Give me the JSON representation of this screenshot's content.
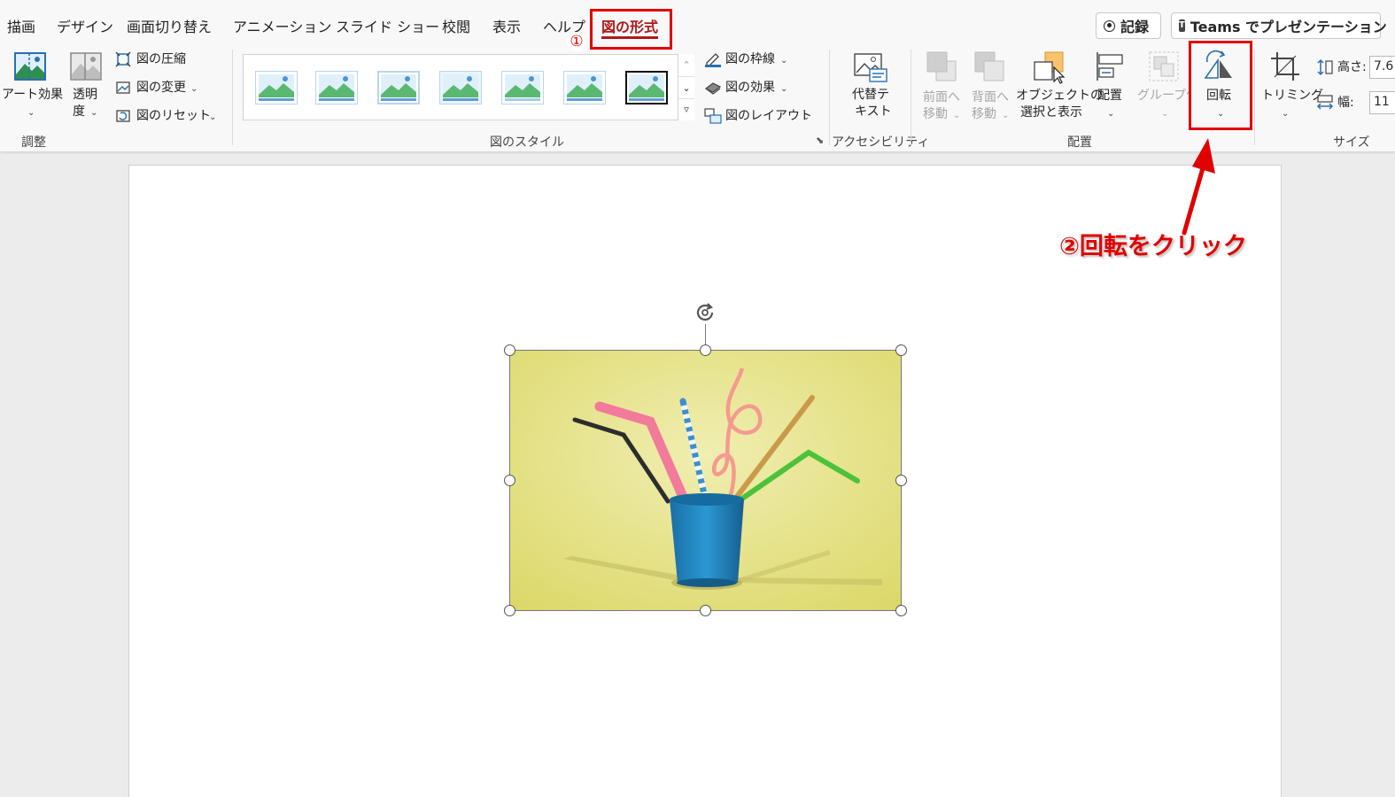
{
  "tabs": [
    {
      "label": "描画"
    },
    {
      "label": "デザイン"
    },
    {
      "label": "画面切り替え"
    },
    {
      "label": "アニメーション"
    },
    {
      "label": "スライド ショー"
    },
    {
      "label": "校閲"
    },
    {
      "label": "表示"
    },
    {
      "label": "ヘルプ"
    },
    {
      "label": "図の形式",
      "active": true
    }
  ],
  "top_buttons": {
    "record_label": "記録",
    "teams_label": "Teams でプレゼンテーション"
  },
  "adjust_group": {
    "art_effects": "アート効果",
    "transparency_line1": "透明",
    "transparency_line2": "度",
    "compress": "図の圧縮",
    "change": "図の変更",
    "reset": "図のリセット",
    "group_label": "調整"
  },
  "styles_group": {
    "thumbnail_count": 7,
    "border": "図の枠線",
    "effects": "図の効果",
    "layout": "図のレイアウト",
    "group_label": "図のスタイル"
  },
  "accessibility_group": {
    "alt_text_line1": "代替テ",
    "alt_text_line2": "キスト",
    "group_label": "アクセシビリティ"
  },
  "arrange_group": {
    "bring_forward_line1": "前面へ",
    "bring_forward_line2": "移動",
    "send_backward_line1": "背面へ",
    "send_backward_line2": "移動",
    "selection_pane_line1": "オブジェクトの",
    "selection_pane_line2": "選択と表示",
    "align": "配置",
    "group": "グループ化",
    "rotate": "回転",
    "group_label": "配置"
  },
  "size_group": {
    "crop": "トリミング",
    "height_label": "高さ:",
    "height_value": "7.6",
    "width_label": "幅:",
    "width_value": "11",
    "group_label": "サイズ"
  },
  "annotations": {
    "step1_marker": "①",
    "step2_text": "②回転をクリック"
  },
  "colors": {
    "annotation_red": "#e00000",
    "active_tab": "#b01818",
    "photo_bg": "#e8e593",
    "cup_blue": "#1f86c4"
  }
}
